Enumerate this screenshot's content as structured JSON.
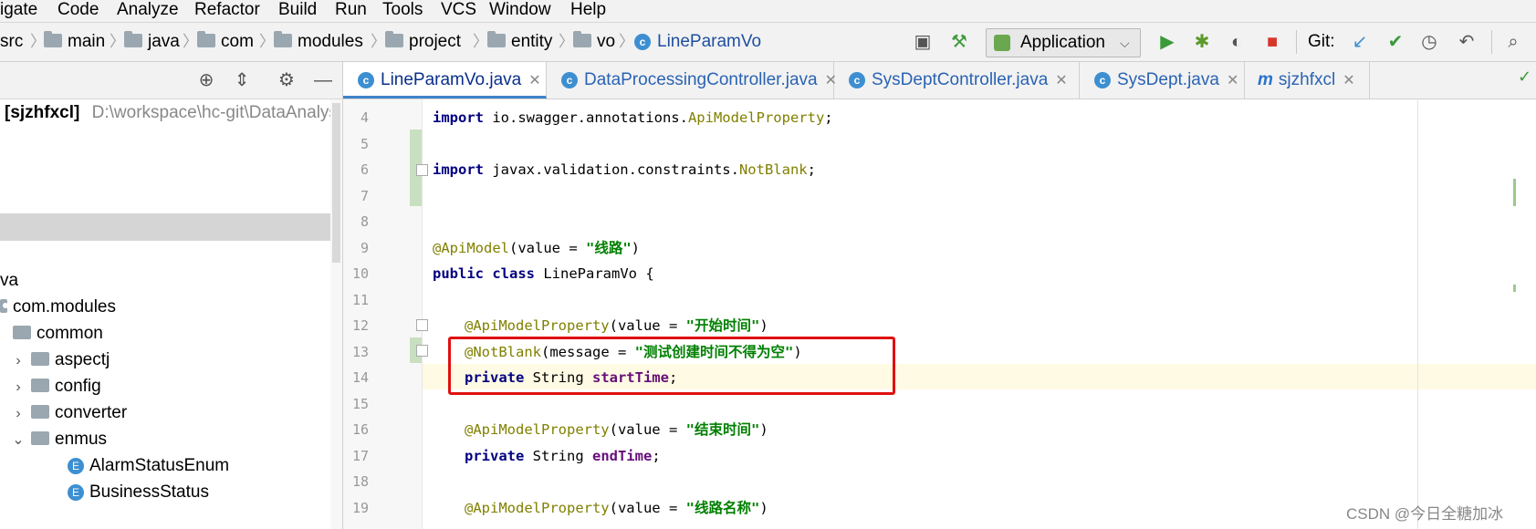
{
  "menu": [
    "igate",
    "Code",
    "Analyze",
    "Refactor",
    "Build",
    "Run",
    "Tools",
    "VCS",
    "Window",
    "Help"
  ],
  "breadcrumb": [
    "src",
    "main",
    "java",
    "com",
    "modules",
    "project",
    "entity",
    "vo",
    "LineParamVo"
  ],
  "toolbar": {
    "run_config": "Application",
    "git_label": "Git:",
    "icons": [
      "frame-icon",
      "build-hammer-icon",
      "run-icon",
      "debug-icon",
      "coverage-icon",
      "stop-icon",
      "git-update-icon",
      "git-commit-icon",
      "history-icon",
      "rollback-icon",
      "search-icon"
    ]
  },
  "project": {
    "root_name": "[sjzhfxcl]",
    "root_path": "D:\\workspace\\hc-git\\DataAnalys",
    "tree": [
      {
        "label": "va"
      },
      {
        "label": "com.modules"
      },
      {
        "label": "common"
      },
      {
        "label": "aspectj"
      },
      {
        "label": "config"
      },
      {
        "label": "converter"
      },
      {
        "label": "enmus"
      },
      {
        "label": "AlarmStatusEnum"
      },
      {
        "label": "BusinessStatus"
      }
    ],
    "head_icons": [
      "locate-icon",
      "collapse-icon",
      "settings-icon",
      "hide-icon"
    ]
  },
  "tabs": [
    {
      "label": "LineParamVo.java",
      "icon": "C",
      "active": true
    },
    {
      "label": "DataProcessingController.java",
      "icon": "C"
    },
    {
      "label": "SysDeptController.java",
      "icon": "C"
    },
    {
      "label": "SysDept.java",
      "icon": "C"
    },
    {
      "label": "sjzhfxcl",
      "icon": "m"
    }
  ],
  "code": {
    "line_numbers": [
      "4",
      "5",
      "6",
      "7",
      "8",
      "9",
      "10",
      "11",
      "12",
      "13",
      "14",
      "15",
      "16",
      "17",
      "18",
      "19"
    ],
    "l4_kw": "import",
    "l4_rest": " io.swagger.annotations.",
    "l4_cls": "ApiModelProperty",
    "l4_end": ";",
    "l6_kw": "import",
    "l6_rest": " javax.validation.constraints.",
    "l6_cls": "NotBlank",
    "l6_end": ";",
    "l9_an": "@ApiModel",
    "l9_mid": "(value = ",
    "l9_str": "\"线路\"",
    "l9_end": ")",
    "l10_kw1": "public",
    "l10_kw2": "class",
    "l10_rest": " LineParamVo {",
    "l12_an": "@ApiModelProperty",
    "l12_mid": "(value = ",
    "l12_str": "\"开始时间\"",
    "l12_end": ")",
    "l13_an": "@NotBlank",
    "l13_mid": "(message = ",
    "l13_str": "\"测试创建时间不得为空\"",
    "l13_end": ")",
    "l14_kw": "private",
    "l14_type": " String ",
    "l14_field": "startTime",
    "l14_end": ";",
    "l16_an": "@ApiModelProperty",
    "l16_mid": "(value = ",
    "l16_str": "\"结束时间\"",
    "l16_end": ")",
    "l17_kw": "private",
    "l17_type": " String ",
    "l17_field": "endTime",
    "l17_end": ";",
    "l19_an": "@ApiModelProperty",
    "l19_mid": "(value = ",
    "l19_str": "\"线路名称\"",
    "l19_end": ")"
  },
  "watermark": "CSDN @今日全糖加冰",
  "colors": {
    "accent": "#4083c9",
    "highlight_box": "#e01010",
    "keyword": "#000080",
    "annotation": "#808000",
    "string": "#008000",
    "field": "#660e7a"
  }
}
